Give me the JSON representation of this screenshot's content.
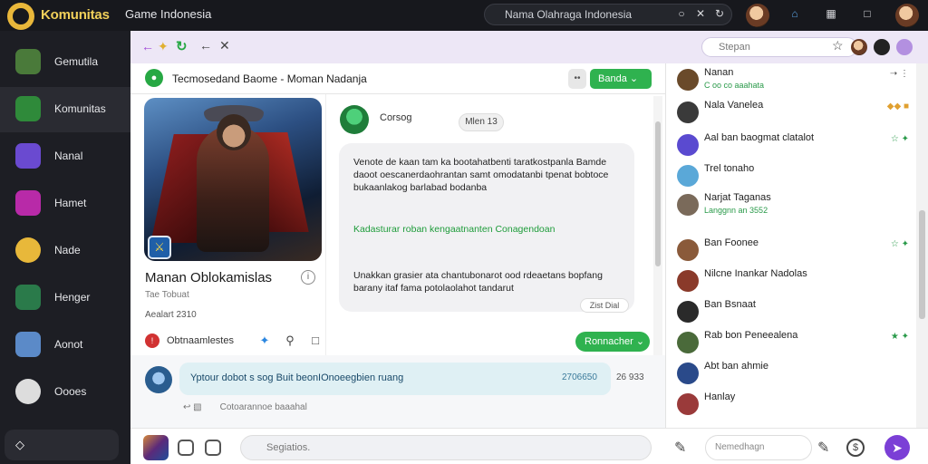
{
  "topbar": {
    "brand": "Komunitas",
    "brand_sub": "Game Indonesia",
    "search_text": "Nama Olahraga Indonesia",
    "icons": [
      "circle-icon",
      "shuffle-icon",
      "refresh-icon",
      "home-icon",
      "gamepad-icon",
      "window-icon"
    ]
  },
  "sidebar": {
    "items": [
      {
        "label": "Gemutila",
        "color": "#4a7a3a"
      },
      {
        "label": "Komunitas",
        "color": "#2f8a3a"
      },
      {
        "label": "Nanal",
        "color": "#6a4ad0"
      },
      {
        "label": "Hamet",
        "color": "#b82aa8"
      },
      {
        "label": "Nade",
        "color": "#e8b83a"
      },
      {
        "label": "Henger",
        "color": "#2a7a4a"
      },
      {
        "label": "Aonot",
        "color": "#5b8ac8"
      },
      {
        "label": "Oooes",
        "color": "#aaaaaa"
      }
    ],
    "bottom_label": "◇"
  },
  "browser": {
    "search_placeholder": "Stepan"
  },
  "chat": {
    "title": "Tecmosedand Baome - Moman Nadanja",
    "btn_green": "Banda"
  },
  "profile": {
    "name": "Manan Oblokamislas",
    "sub": "Tae Tobuat",
    "meta": "Aealart 2310"
  },
  "conversation": {
    "bot_name": "Corsog",
    "pill": "Mlen 13",
    "msg1": "Venote de kaan tam ka bootahatbenti taratkostpanla Bamde daoot oescanerdaohrantan samt omodatanbi tpenat bobtoce bukaanlakog barlabad bodanba",
    "msg2": "Kadasturar roban kengaatnanten Conagendoan",
    "msg3": "Unakkan grasier ata chantubonarot ood rdeaetans bopfang barany itaf fama potolaolahot tandarut",
    "time": "Zist Dial"
  },
  "actionbar": {
    "label": "Obtnaamlestes",
    "button": "Ronnacher"
  },
  "reply": {
    "text": "Yptour dobot s sog Buit beonIOnoeegbien ruang",
    "time": "2706650",
    "time2": "26 933",
    "meta": "Cotoarannoe baaahal"
  },
  "composer": {
    "placeholder": "Segiatios.",
    "placeholder2": "Nemedhagn"
  },
  "friends": [
    {
      "name": "Nanan",
      "status": "C oo co aaahata",
      "right": "",
      "color": "#6a4a2a"
    },
    {
      "name": "Nala Vanelea",
      "status": "",
      "right": "",
      "color": "#3a3a3a"
    },
    {
      "name": "Aal ban baogmat clatalot",
      "status": "",
      "right": "",
      "color": "#5a4ad0"
    },
    {
      "name": "Trel tonaho",
      "status": "",
      "right": "",
      "color": "#5aa8d8"
    },
    {
      "name": "Narjat Taganas",
      "status": "Langgnn an 3552",
      "right": "",
      "color": "#7a6a5a"
    },
    {
      "name": "Ban Foonee",
      "status": "",
      "right": "",
      "color": "#8a5a3a"
    },
    {
      "name": "Nilcne Inankar Nadolas",
      "status": "",
      "right": "",
      "color": "#8a3a2a"
    },
    {
      "name": "Ban Bsnaat",
      "status": "",
      "right": "",
      "color": "#2a2a2a"
    },
    {
      "name": "Rab bon Peneealena",
      "status": "",
      "right": "",
      "color": "#4a6a3a"
    },
    {
      "name": "Abt ban ahmie",
      "status": "",
      "right": "",
      "color": "#2a4a8a"
    },
    {
      "name": "Hanlay",
      "status": "",
      "right": "",
      "color": "#9a3a3a"
    }
  ]
}
